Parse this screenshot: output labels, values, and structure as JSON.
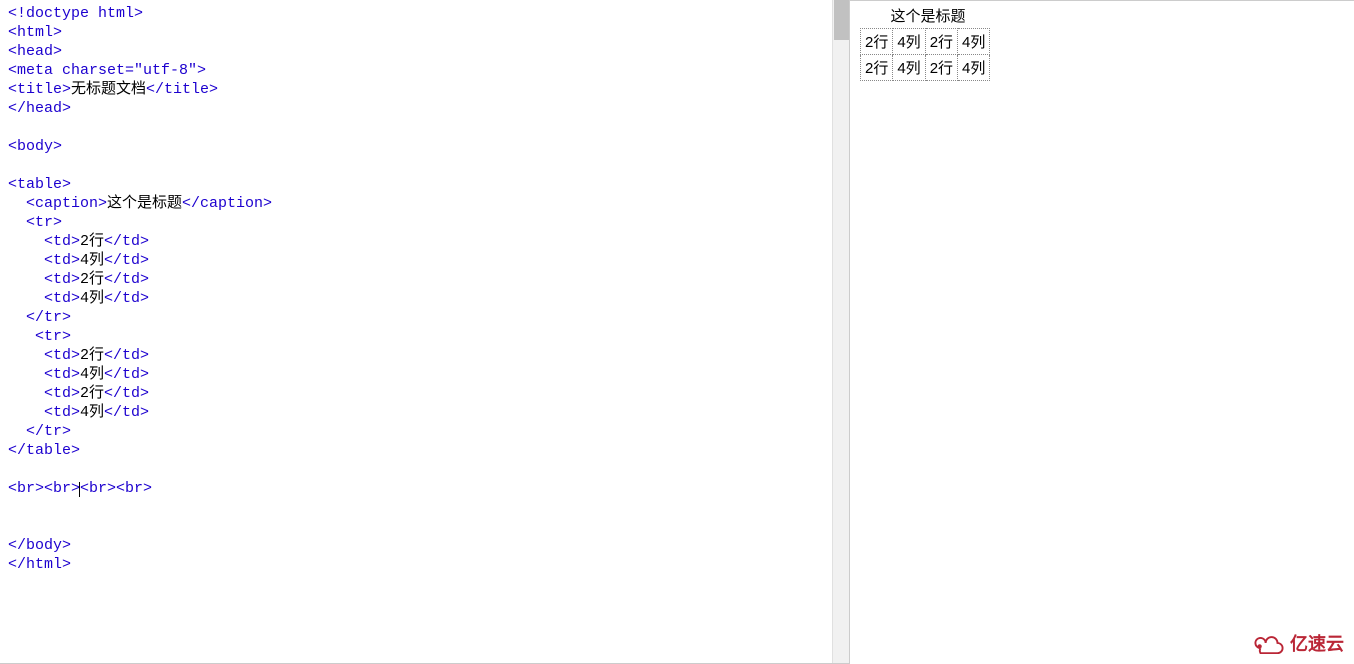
{
  "code": {
    "l1": "<!doctype html>",
    "l2": "<html>",
    "l3": "<head>",
    "l4_open": "<meta charset=",
    "l4_val": "\"utf-8\"",
    "l4_close": ">",
    "l5_open": "<title>",
    "l5_text": "无标题文档",
    "l5_close": "</title>",
    "l6": "</head>",
    "l7": "",
    "l8": "<body>",
    "l9": "",
    "l10": "<table>",
    "l11_open": "  <caption>",
    "l11_text": "这个是标题",
    "l11_close": "</caption>",
    "l12": "  <tr>",
    "td_open": "    <td>",
    "cell_2row": "2行",
    "cell_4col": "4列",
    "td_close": "</td>",
    "l17": "  </tr>",
    "l18": "   <tr>",
    "l23": "  </tr>",
    "l24": "</table>",
    "l25": "",
    "l26_a": "<br><br>",
    "l26_b": "<br><br>",
    "l27": "",
    "l28": "",
    "l29": "</body>",
    "l30": "</html>"
  },
  "preview": {
    "caption": "这个是标题",
    "rows": [
      [
        "2行",
        "4列",
        "2行",
        "4列"
      ],
      [
        "2行",
        "4列",
        "2行",
        "4列"
      ]
    ]
  },
  "watermark": "亿速云"
}
